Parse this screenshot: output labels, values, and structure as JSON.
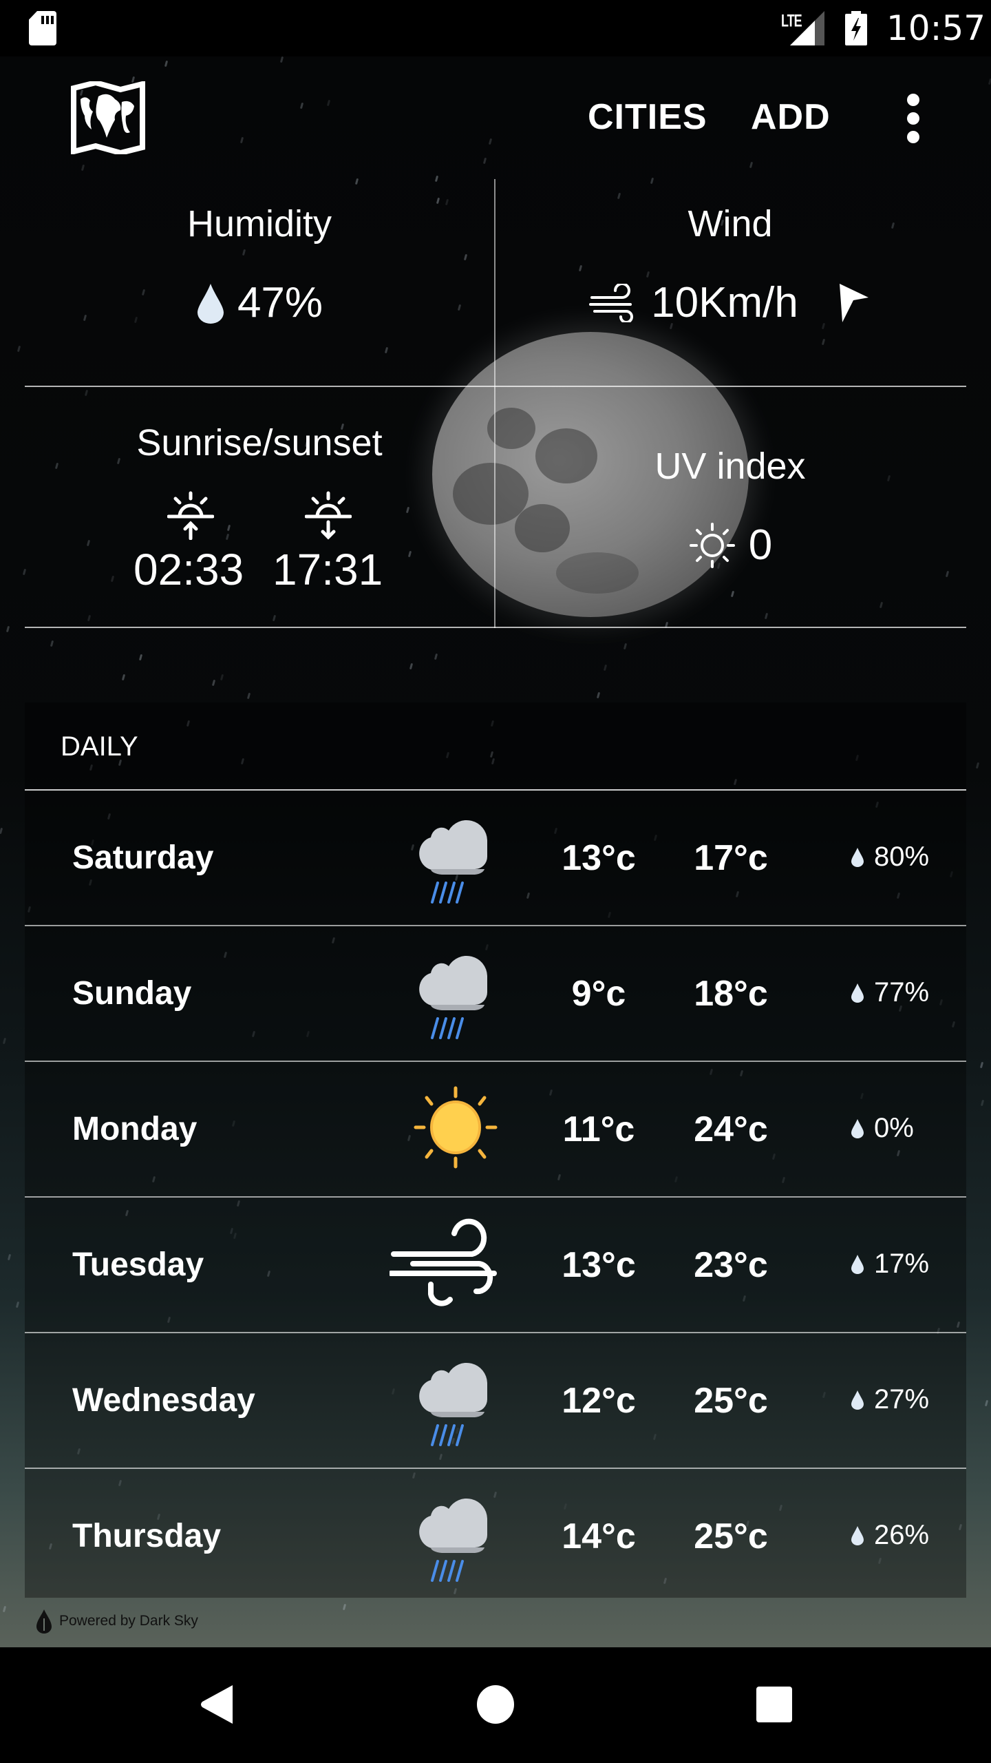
{
  "status_bar": {
    "time": "10:57",
    "network": "LTE",
    "icons": [
      "sd-card-icon",
      "lte-signal-icon",
      "battery-charging-icon"
    ]
  },
  "toolbar": {
    "logo_icon": "world-map-icon",
    "cities_label": "CITIES",
    "add_label": "ADD",
    "more_icon": "more-vert-icon"
  },
  "current": {
    "humidity": {
      "label": "Humidity",
      "value": "47%",
      "icon": "raindrop-icon"
    },
    "wind": {
      "label": "Wind",
      "value": "10Km/h",
      "icon": "wind-icon",
      "direction_icon": "wind-direction-arrow-icon"
    },
    "sun": {
      "label": "Sunrise/sunset",
      "sunrise": "02:33",
      "sunset": "17:31",
      "icons": [
        "sunrise-icon",
        "sunset-icon"
      ]
    },
    "uv": {
      "label": "UV index",
      "value": "0",
      "icon": "sun-outline-icon"
    },
    "background": "moon-image"
  },
  "daily": {
    "title": "DAILY",
    "days": [
      {
        "day": "Saturday",
        "icon": "rain",
        "low": "13°c",
        "high": "17°c",
        "precip": "80%"
      },
      {
        "day": "Sunday",
        "icon": "rain",
        "low": "9°c",
        "high": "18°c",
        "precip": "77%"
      },
      {
        "day": "Monday",
        "icon": "clear-day",
        "low": "11°c",
        "high": "24°c",
        "precip": "0%"
      },
      {
        "day": "Tuesday",
        "icon": "wind",
        "low": "13°c",
        "high": "23°c",
        "precip": "17%"
      },
      {
        "day": "Wednesday",
        "icon": "rain",
        "low": "12°c",
        "high": "25°c",
        "precip": "27%"
      },
      {
        "day": "Thursday",
        "icon": "rain",
        "low": "14°c",
        "high": "25°c",
        "precip": "26%"
      }
    ]
  },
  "footer": {
    "attribution": "Powered by Dark Sky"
  },
  "colors": {
    "sun": "#ffd04e",
    "sun_rays": "#f5b53d",
    "cloud": "#cdd1d6",
    "rain": "#4a8de8",
    "drop": "#dfeaf5"
  },
  "nav": {
    "back": "back-icon",
    "home": "home-icon",
    "recents": "recents-icon"
  }
}
